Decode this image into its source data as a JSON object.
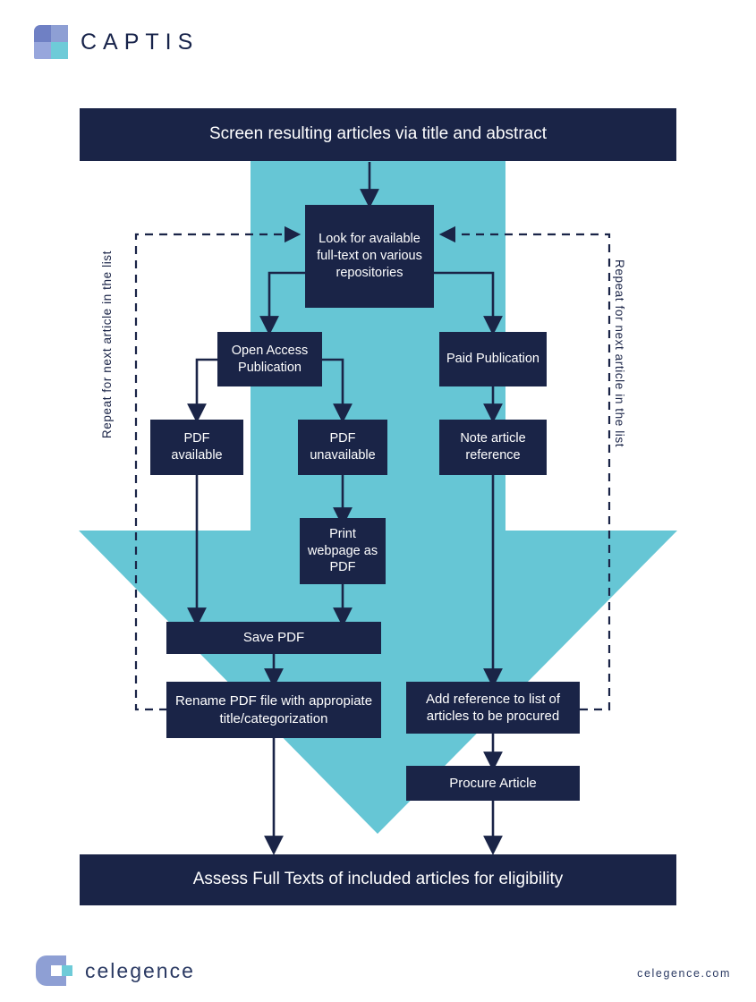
{
  "brand": {
    "header_logo_name": "captis-logo",
    "header_wordmark": "CAPTIS",
    "footer_logo_name": "celegence-logo",
    "footer_wordmark": "celegence",
    "website": "celegence.com"
  },
  "colors": {
    "navy": "#1a2447",
    "teal": "#66c6d5",
    "white": "#ffffff",
    "logo_blue_dark": "#6f80c4",
    "logo_blue_light": "#8e9fd4",
    "logo_teal": "#6ecbd8"
  },
  "diagram": {
    "type": "flowchart",
    "title": "Full-text retrieval workflow",
    "banners": {
      "top": "Screen resulting articles via title and abstract",
      "bottom": "Assess Full Texts of included articles for eligibility"
    },
    "side_labels": {
      "left": "Repeat for next article in the list",
      "right": "Repeat for next article in the list"
    },
    "nodes": [
      {
        "id": "screen",
        "label": "Screen resulting articles via title and abstract"
      },
      {
        "id": "lookup",
        "label": "Look for available full-text on various repositories"
      },
      {
        "id": "open_access",
        "label": "Open Access Publication"
      },
      {
        "id": "paid",
        "label": "Paid Publication"
      },
      {
        "id": "pdf_avail",
        "label": "PDF available"
      },
      {
        "id": "pdf_unavail",
        "label": "PDF unavailable"
      },
      {
        "id": "note_ref",
        "label": "Note article reference"
      },
      {
        "id": "print_pdf",
        "label": "Print webpage as PDF"
      },
      {
        "id": "save_pdf",
        "label": "Save PDF"
      },
      {
        "id": "rename_pdf",
        "label": "Rename PDF file with appropiate title/categorization"
      },
      {
        "id": "add_ref",
        "label": "Add reference to list of articles to be procured"
      },
      {
        "id": "procure",
        "label": "Procure Article"
      },
      {
        "id": "assess",
        "label": "Assess Full Texts of included articles for eligibility"
      }
    ],
    "edges": [
      {
        "from": "screen",
        "to": "lookup",
        "style": "solid"
      },
      {
        "from": "lookup",
        "to": "open_access",
        "style": "solid"
      },
      {
        "from": "lookup",
        "to": "paid",
        "style": "solid"
      },
      {
        "from": "open_access",
        "to": "pdf_avail",
        "style": "solid"
      },
      {
        "from": "open_access",
        "to": "pdf_unavail",
        "style": "solid"
      },
      {
        "from": "paid",
        "to": "note_ref",
        "style": "solid"
      },
      {
        "from": "pdf_unavail",
        "to": "print_pdf",
        "style": "solid"
      },
      {
        "from": "pdf_avail",
        "to": "save_pdf",
        "style": "solid"
      },
      {
        "from": "print_pdf",
        "to": "save_pdf",
        "style": "solid"
      },
      {
        "from": "save_pdf",
        "to": "rename_pdf",
        "style": "solid"
      },
      {
        "from": "note_ref",
        "to": "add_ref",
        "style": "solid"
      },
      {
        "from": "add_ref",
        "to": "procure",
        "style": "solid"
      },
      {
        "from": "rename_pdf",
        "to": "assess",
        "style": "solid"
      },
      {
        "from": "procure",
        "to": "assess",
        "style": "solid"
      },
      {
        "from": "rename_pdf",
        "to": "lookup",
        "style": "dashed",
        "label": "Repeat for next article in the list"
      },
      {
        "from": "add_ref",
        "to": "lookup",
        "style": "dashed",
        "label": "Repeat for next article in the list"
      }
    ]
  }
}
